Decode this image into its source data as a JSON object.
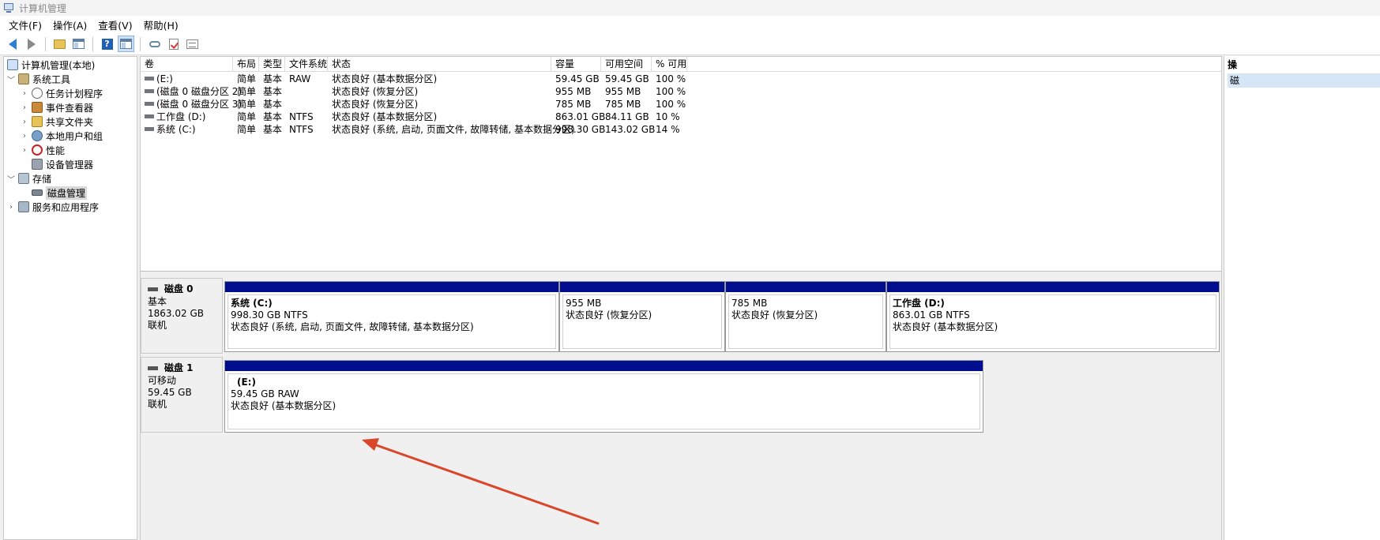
{
  "window": {
    "title": "计算机管理"
  },
  "menu": {
    "items": [
      "文件(F)",
      "操作(A)",
      "查看(V)",
      "帮助(H)"
    ]
  },
  "toolbar": {
    "icons": [
      "back-icon",
      "forward-icon",
      "up-folder-icon",
      "show-hide-tree-icon",
      "help-icon",
      "properties-icon",
      "connect-icon",
      "check-icon",
      "list-icon"
    ]
  },
  "tree": {
    "root": "计算机管理(本地)",
    "items": [
      {
        "label": "系统工具",
        "level": 1,
        "expanded": true,
        "icon": "tools-icon"
      },
      {
        "label": "任务计划程序",
        "level": 2,
        "expanded": false,
        "icon": "clock-icon"
      },
      {
        "label": "事件查看器",
        "level": 2,
        "expanded": false,
        "icon": "event-viewer-icon"
      },
      {
        "label": "共享文件夹",
        "level": 2,
        "expanded": false,
        "icon": "shared-folder-icon"
      },
      {
        "label": "本地用户和组",
        "level": 2,
        "expanded": false,
        "icon": "users-icon"
      },
      {
        "label": "性能",
        "level": 2,
        "expanded": false,
        "icon": "performance-icon"
      },
      {
        "label": "设备管理器",
        "level": 2,
        "expanded": null,
        "icon": "device-manager-icon"
      },
      {
        "label": "存储",
        "level": 1,
        "expanded": true,
        "icon": "storage-icon"
      },
      {
        "label": "磁盘管理",
        "level": 2,
        "expanded": null,
        "icon": "disk-icon",
        "selected": true
      },
      {
        "label": "服务和应用程序",
        "level": 1,
        "expanded": false,
        "icon": "services-icon"
      }
    ]
  },
  "volume_list": {
    "columns": [
      "卷",
      "布局",
      "类型",
      "文件系统",
      "状态",
      "容量",
      "可用空间",
      "% 可用"
    ],
    "rows": [
      {
        "volume": "(E:)",
        "layout": "简单",
        "type": "基本",
        "fs": "RAW",
        "status": "状态良好 (基本数据分区)",
        "capacity": "59.45 GB",
        "free": "59.45 GB",
        "pct": "100 %"
      },
      {
        "volume": "(磁盘 0 磁盘分区 2)",
        "layout": "简单",
        "type": "基本",
        "fs": "",
        "status": "状态良好 (恢复分区)",
        "capacity": "955 MB",
        "free": "955 MB",
        "pct": "100 %"
      },
      {
        "volume": "(磁盘 0 磁盘分区 3)",
        "layout": "简单",
        "type": "基本",
        "fs": "",
        "status": "状态良好 (恢复分区)",
        "capacity": "785 MB",
        "free": "785 MB",
        "pct": "100 %"
      },
      {
        "volume": "工作盘 (D:)",
        "layout": "简单",
        "type": "基本",
        "fs": "NTFS",
        "status": "状态良好 (基本数据分区)",
        "capacity": "863.01 GB",
        "free": "84.11 GB",
        "pct": "10 %"
      },
      {
        "volume": "系统 (C:)",
        "layout": "简单",
        "type": "基本",
        "fs": "NTFS",
        "status": "状态良好 (系统, 启动, 页面文件, 故障转储, 基本数据分区)",
        "capacity": "998.30 GB",
        "free": "143.02 GB",
        "pct": "14 %"
      }
    ]
  },
  "disks": [
    {
      "name": "磁盘 0",
      "kind": "基本",
      "size": "1863.02 GB",
      "state": "联机",
      "partitions": [
        {
          "name": "系统  (C:)",
          "size": "998.30 GB NTFS",
          "status": "状态良好 (系统, 启动, 页面文件, 故障转储, 基本数据分区)"
        },
        {
          "name": "",
          "size": "955 MB",
          "status": "状态良好 (恢复分区)"
        },
        {
          "name": "",
          "size": "785 MB",
          "status": "状态良好 (恢复分区)"
        },
        {
          "name": "工作盘  (D:)",
          "size": "863.01 GB NTFS",
          "status": "状态良好 (基本数据分区)"
        }
      ]
    },
    {
      "name": "磁盘 1",
      "kind": "可移动",
      "size": "59.45 GB",
      "state": "联机",
      "partitions": [
        {
          "name": "(E:)",
          "size": "59.45 GB RAW",
          "status": "状态良好 (基本数据分区)"
        }
      ]
    }
  ],
  "actions": {
    "header": "操",
    "item": "磁"
  },
  "colors": {
    "partition_bar": "#000d8c",
    "annotation_arrow": "#d9462a",
    "selected_tree": "#d9d9d9"
  }
}
